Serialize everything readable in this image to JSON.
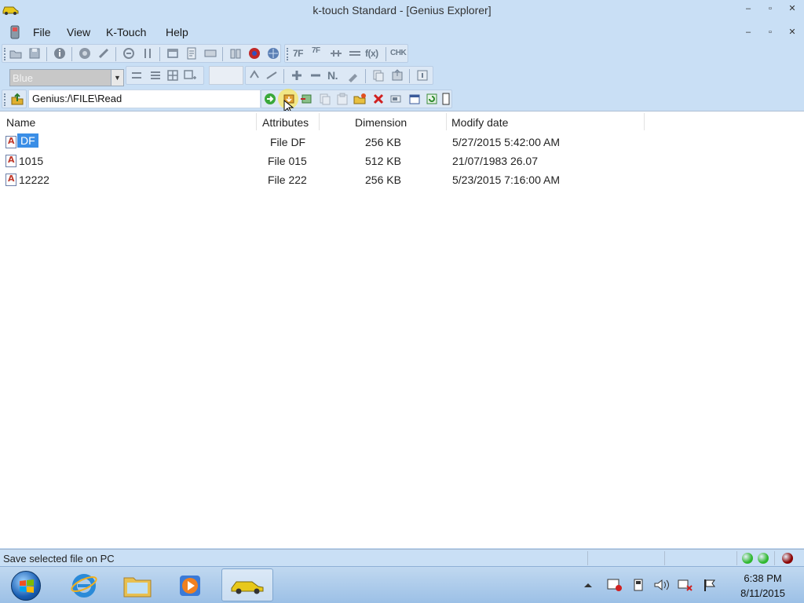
{
  "window": {
    "title": "k-touch Standard - [Genius Explorer]",
    "minimize": "–",
    "maximize": "▫",
    "close": "✕"
  },
  "menu": {
    "items": [
      "File",
      "View",
      "K-Touch",
      "Help"
    ]
  },
  "toolbar": {
    "text_icons": [
      "7F",
      "7F",
      "f(x)",
      "CHK",
      "N."
    ],
    "color_combo": {
      "value": "Blue"
    }
  },
  "address": {
    "path": "Genius:/\\FILE\\Read"
  },
  "file_list": {
    "columns": [
      "Name",
      "Attributes",
      "Dimension",
      "Modify date"
    ],
    "rows": [
      {
        "name": "DF",
        "attributes": "File DF",
        "dimension": "256 KB",
        "modified": "5/27/2015 5:42:00 AM",
        "selected": true
      },
      {
        "name": "1015",
        "attributes": "File 015",
        "dimension": "512 KB",
        "modified": "21/07/1983 26.07",
        "selected": false
      },
      {
        "name": "12222",
        "attributes": "File 222",
        "dimension": "256 KB",
        "modified": "5/23/2015 7:16:00 AM",
        "selected": false
      }
    ]
  },
  "status": {
    "text": "Save selected file on PC",
    "led_colors": [
      "#2fb82f",
      "#2fb82f",
      "#8b0000"
    ]
  },
  "taskbar": {
    "time": "6:38 PM",
    "date": "8/11/2015"
  },
  "colors": {
    "chrome": "#c9dff5",
    "selection": "#3a8ee6"
  }
}
